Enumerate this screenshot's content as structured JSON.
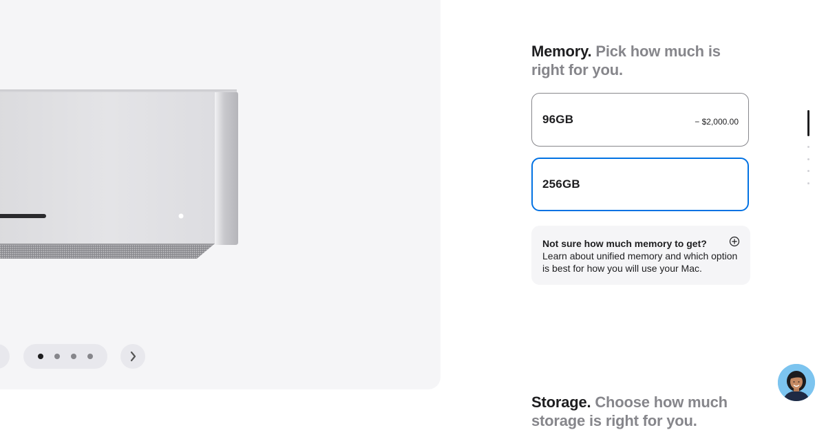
{
  "gallery": {
    "image": "mac-studio-front-view",
    "prev_icon": "chevron-left-icon",
    "next_icon": "chevron-right-icon",
    "dots": [
      {
        "active": true
      },
      {
        "active": false
      },
      {
        "active": false
      },
      {
        "active": false
      }
    ]
  },
  "memory": {
    "title": "Memory.",
    "subtitle": "Pick how much is right for you.",
    "options": [
      {
        "label": "96GB",
        "price": "− $2,000.00",
        "selected": false
      },
      {
        "label": "256GB",
        "price": "",
        "selected": true
      }
    ],
    "help": {
      "question": "Not sure how much memory to get?",
      "text": "Learn about unified memory and which option is best for how you will use your Mac.",
      "icon": "plus-circle-icon"
    }
  },
  "storage": {
    "title": "Storage.",
    "subtitle": "Choose how much storage is right for you."
  },
  "progress_nav": {
    "sections": 5,
    "active_index": 0
  },
  "chat": {
    "icon": "specialist-avatar"
  },
  "colors": {
    "accent": "#0071e3",
    "text": "#1d1d1f",
    "secondary": "#86868b",
    "panel_bg": "#f5f5f7"
  }
}
